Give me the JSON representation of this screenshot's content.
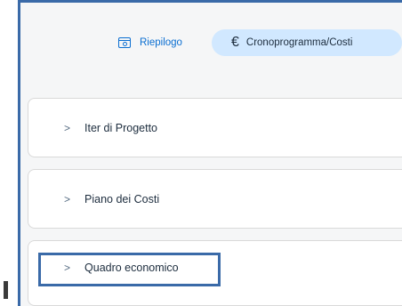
{
  "tabs": [
    {
      "label": "Riepilogo",
      "icon": "summary-icon",
      "selected": false
    },
    {
      "label": "Cronoprogramma/Costi",
      "icon": "euro-icon",
      "selected": true
    }
  ],
  "sections": [
    {
      "label": "Iter di Progetto",
      "expanded": false
    },
    {
      "label": "Piano dei Costi",
      "expanded": false
    },
    {
      "label": "Quadro economico",
      "expanded": false
    }
  ],
  "chevron_glyph": ">",
  "euro_glyph": "€",
  "colors": {
    "accent": "#0a6ed1",
    "selected_tab_bg": "#d1e8ff",
    "highlight": "#3a6aa8"
  }
}
